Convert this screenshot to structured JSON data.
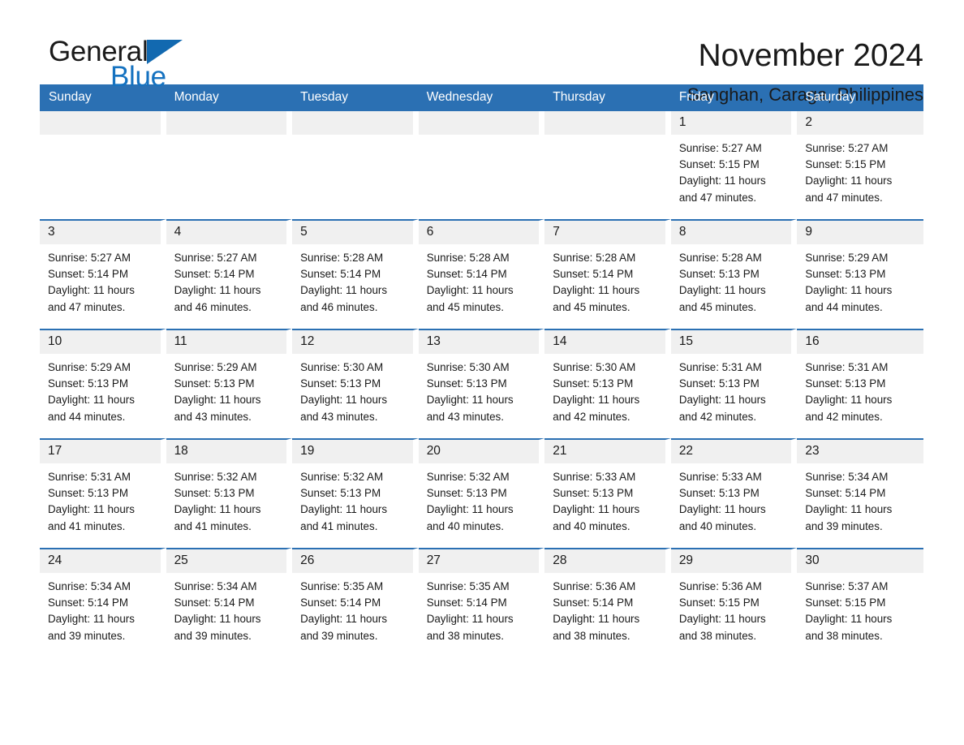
{
  "brand": {
    "name_part1": "General",
    "name_part2": "Blue",
    "triangle_color": "#1269b0",
    "blue_color": "#1572c0"
  },
  "header": {
    "month_title": "November 2024",
    "location": "Sanghan, Caraga, Philippines"
  },
  "theme": {
    "header_bar_color": "#2b70b3",
    "day_header_bg": "#f0f0f0",
    "page_bg": "#ffffff",
    "text_color": "#1a1a1a"
  },
  "weekdays": [
    "Sunday",
    "Monday",
    "Tuesday",
    "Wednesday",
    "Thursday",
    "Friday",
    "Saturday"
  ],
  "weeks": [
    [
      {
        "day": "",
        "sunrise": "",
        "sunset": "",
        "daylight_line1": "",
        "daylight_line2": "",
        "empty": true
      },
      {
        "day": "",
        "sunrise": "",
        "sunset": "",
        "daylight_line1": "",
        "daylight_line2": "",
        "empty": true
      },
      {
        "day": "",
        "sunrise": "",
        "sunset": "",
        "daylight_line1": "",
        "daylight_line2": "",
        "empty": true
      },
      {
        "day": "",
        "sunrise": "",
        "sunset": "",
        "daylight_line1": "",
        "daylight_line2": "",
        "empty": true
      },
      {
        "day": "",
        "sunrise": "",
        "sunset": "",
        "daylight_line1": "",
        "daylight_line2": "",
        "empty": true
      },
      {
        "day": "1",
        "sunrise": "Sunrise: 5:27 AM",
        "sunset": "Sunset: 5:15 PM",
        "daylight_line1": "Daylight: 11 hours",
        "daylight_line2": "and 47 minutes.",
        "empty": false
      },
      {
        "day": "2",
        "sunrise": "Sunrise: 5:27 AM",
        "sunset": "Sunset: 5:15 PM",
        "daylight_line1": "Daylight: 11 hours",
        "daylight_line2": "and 47 minutes.",
        "empty": false
      }
    ],
    [
      {
        "day": "3",
        "sunrise": "Sunrise: 5:27 AM",
        "sunset": "Sunset: 5:14 PM",
        "daylight_line1": "Daylight: 11 hours",
        "daylight_line2": "and 47 minutes.",
        "empty": false
      },
      {
        "day": "4",
        "sunrise": "Sunrise: 5:27 AM",
        "sunset": "Sunset: 5:14 PM",
        "daylight_line1": "Daylight: 11 hours",
        "daylight_line2": "and 46 minutes.",
        "empty": false
      },
      {
        "day": "5",
        "sunrise": "Sunrise: 5:28 AM",
        "sunset": "Sunset: 5:14 PM",
        "daylight_line1": "Daylight: 11 hours",
        "daylight_line2": "and 46 minutes.",
        "empty": false
      },
      {
        "day": "6",
        "sunrise": "Sunrise: 5:28 AM",
        "sunset": "Sunset: 5:14 PM",
        "daylight_line1": "Daylight: 11 hours",
        "daylight_line2": "and 45 minutes.",
        "empty": false
      },
      {
        "day": "7",
        "sunrise": "Sunrise: 5:28 AM",
        "sunset": "Sunset: 5:14 PM",
        "daylight_line1": "Daylight: 11 hours",
        "daylight_line2": "and 45 minutes.",
        "empty": false
      },
      {
        "day": "8",
        "sunrise": "Sunrise: 5:28 AM",
        "sunset": "Sunset: 5:13 PM",
        "daylight_line1": "Daylight: 11 hours",
        "daylight_line2": "and 45 minutes.",
        "empty": false
      },
      {
        "day": "9",
        "sunrise": "Sunrise: 5:29 AM",
        "sunset": "Sunset: 5:13 PM",
        "daylight_line1": "Daylight: 11 hours",
        "daylight_line2": "and 44 minutes.",
        "empty": false
      }
    ],
    [
      {
        "day": "10",
        "sunrise": "Sunrise: 5:29 AM",
        "sunset": "Sunset: 5:13 PM",
        "daylight_line1": "Daylight: 11 hours",
        "daylight_line2": "and 44 minutes.",
        "empty": false
      },
      {
        "day": "11",
        "sunrise": "Sunrise: 5:29 AM",
        "sunset": "Sunset: 5:13 PM",
        "daylight_line1": "Daylight: 11 hours",
        "daylight_line2": "and 43 minutes.",
        "empty": false
      },
      {
        "day": "12",
        "sunrise": "Sunrise: 5:30 AM",
        "sunset": "Sunset: 5:13 PM",
        "daylight_line1": "Daylight: 11 hours",
        "daylight_line2": "and 43 minutes.",
        "empty": false
      },
      {
        "day": "13",
        "sunrise": "Sunrise: 5:30 AM",
        "sunset": "Sunset: 5:13 PM",
        "daylight_line1": "Daylight: 11 hours",
        "daylight_line2": "and 43 minutes.",
        "empty": false
      },
      {
        "day": "14",
        "sunrise": "Sunrise: 5:30 AM",
        "sunset": "Sunset: 5:13 PM",
        "daylight_line1": "Daylight: 11 hours",
        "daylight_line2": "and 42 minutes.",
        "empty": false
      },
      {
        "day": "15",
        "sunrise": "Sunrise: 5:31 AM",
        "sunset": "Sunset: 5:13 PM",
        "daylight_line1": "Daylight: 11 hours",
        "daylight_line2": "and 42 minutes.",
        "empty": false
      },
      {
        "day": "16",
        "sunrise": "Sunrise: 5:31 AM",
        "sunset": "Sunset: 5:13 PM",
        "daylight_line1": "Daylight: 11 hours",
        "daylight_line2": "and 42 minutes.",
        "empty": false
      }
    ],
    [
      {
        "day": "17",
        "sunrise": "Sunrise: 5:31 AM",
        "sunset": "Sunset: 5:13 PM",
        "daylight_line1": "Daylight: 11 hours",
        "daylight_line2": "and 41 minutes.",
        "empty": false
      },
      {
        "day": "18",
        "sunrise": "Sunrise: 5:32 AM",
        "sunset": "Sunset: 5:13 PM",
        "daylight_line1": "Daylight: 11 hours",
        "daylight_line2": "and 41 minutes.",
        "empty": false
      },
      {
        "day": "19",
        "sunrise": "Sunrise: 5:32 AM",
        "sunset": "Sunset: 5:13 PM",
        "daylight_line1": "Daylight: 11 hours",
        "daylight_line2": "and 41 minutes.",
        "empty": false
      },
      {
        "day": "20",
        "sunrise": "Sunrise: 5:32 AM",
        "sunset": "Sunset: 5:13 PM",
        "daylight_line1": "Daylight: 11 hours",
        "daylight_line2": "and 40 minutes.",
        "empty": false
      },
      {
        "day": "21",
        "sunrise": "Sunrise: 5:33 AM",
        "sunset": "Sunset: 5:13 PM",
        "daylight_line1": "Daylight: 11 hours",
        "daylight_line2": "and 40 minutes.",
        "empty": false
      },
      {
        "day": "22",
        "sunrise": "Sunrise: 5:33 AM",
        "sunset": "Sunset: 5:13 PM",
        "daylight_line1": "Daylight: 11 hours",
        "daylight_line2": "and 40 minutes.",
        "empty": false
      },
      {
        "day": "23",
        "sunrise": "Sunrise: 5:34 AM",
        "sunset": "Sunset: 5:14 PM",
        "daylight_line1": "Daylight: 11 hours",
        "daylight_line2": "and 39 minutes.",
        "empty": false
      }
    ],
    [
      {
        "day": "24",
        "sunrise": "Sunrise: 5:34 AM",
        "sunset": "Sunset: 5:14 PM",
        "daylight_line1": "Daylight: 11 hours",
        "daylight_line2": "and 39 minutes.",
        "empty": false
      },
      {
        "day": "25",
        "sunrise": "Sunrise: 5:34 AM",
        "sunset": "Sunset: 5:14 PM",
        "daylight_line1": "Daylight: 11 hours",
        "daylight_line2": "and 39 minutes.",
        "empty": false
      },
      {
        "day": "26",
        "sunrise": "Sunrise: 5:35 AM",
        "sunset": "Sunset: 5:14 PM",
        "daylight_line1": "Daylight: 11 hours",
        "daylight_line2": "and 39 minutes.",
        "empty": false
      },
      {
        "day": "27",
        "sunrise": "Sunrise: 5:35 AM",
        "sunset": "Sunset: 5:14 PM",
        "daylight_line1": "Daylight: 11 hours",
        "daylight_line2": "and 38 minutes.",
        "empty": false
      },
      {
        "day": "28",
        "sunrise": "Sunrise: 5:36 AM",
        "sunset": "Sunset: 5:14 PM",
        "daylight_line1": "Daylight: 11 hours",
        "daylight_line2": "and 38 minutes.",
        "empty": false
      },
      {
        "day": "29",
        "sunrise": "Sunrise: 5:36 AM",
        "sunset": "Sunset: 5:15 PM",
        "daylight_line1": "Daylight: 11 hours",
        "daylight_line2": "and 38 minutes.",
        "empty": false
      },
      {
        "day": "30",
        "sunrise": "Sunrise: 5:37 AM",
        "sunset": "Sunset: 5:15 PM",
        "daylight_line1": "Daylight: 11 hours",
        "daylight_line2": "and 38 minutes.",
        "empty": false
      }
    ]
  ]
}
